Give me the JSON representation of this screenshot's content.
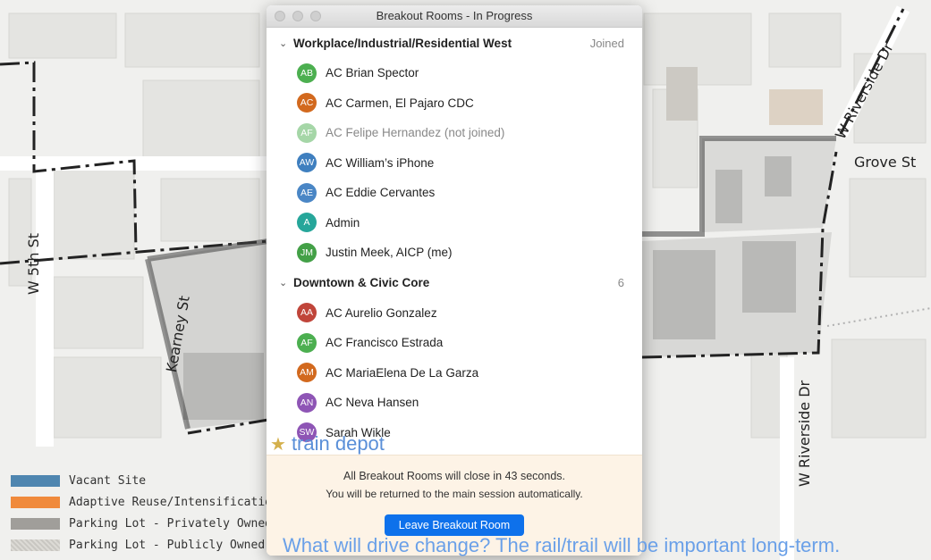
{
  "window": {
    "title": "Breakout Rooms - In Progress"
  },
  "rooms": [
    {
      "name": "Workplace/Industrial/Residential West",
      "status": "Joined",
      "participants": [
        {
          "initials": "AB",
          "name": "AC Brian Spector",
          "color": "#4caf50"
        },
        {
          "initials": "AC",
          "name": "AC Carmen, El Pajaro CDC",
          "color": "#d2691e"
        },
        {
          "initials": "AF",
          "name": "AC Felipe Hernandez (not joined)",
          "color": "#a5d6a7"
        },
        {
          "initials": "AW",
          "name": "AC William’s iPhone",
          "color": "#3f7fbf"
        },
        {
          "initials": "AE",
          "name": "AC Eddie Cervantes",
          "color": "#4a86c5"
        },
        {
          "initials": "A",
          "name": "Admin",
          "color": "#26a69a"
        },
        {
          "initials": "JM",
          "name": "Justin Meek, AICP (me)",
          "color": "#43a047"
        }
      ]
    },
    {
      "name": "Downtown & Civic Core",
      "status": "6",
      "participants": [
        {
          "initials": "AA",
          "name": "AC Aurelio Gonzalez",
          "color": "#c0453a"
        },
        {
          "initials": "AF",
          "name": "AC Francisco Estrada",
          "color": "#4caf50"
        },
        {
          "initials": "AM",
          "name": "AC MariaElena De La Garza",
          "color": "#d2691e"
        },
        {
          "initials": "AN",
          "name": "AC Neva Hansen",
          "color": "#8e55b5"
        },
        {
          "initials": "SW",
          "name": "Sarah Wikle",
          "color": "#8e55b5"
        }
      ]
    }
  ],
  "footer": {
    "countdown": "All Breakout Rooms will close in 43 seconds.",
    "notice": "You will be returned to the main session automatically.",
    "leave_button": "Leave Breakout Room"
  },
  "map": {
    "streets": {
      "w5th": "W 5th St",
      "kearney": "Kearney St",
      "riverside_top": "W Riverside Dr",
      "grove": "Grove St",
      "riverside_right": "W Riverside Dr"
    },
    "legend": [
      {
        "label": "Vacant Site",
        "color": "#4f86b0"
      },
      {
        "label": "Adaptive Reuse/Intensification",
        "color": "#f08a3c"
      },
      {
        "label": "Parking Lot - Privately Owned",
        "color": "#a09e9a"
      },
      {
        "label": "Parking Lot - Publicly Owned",
        "color": "#c9c7c2"
      }
    ]
  },
  "slide": {
    "train_depot": "train depot",
    "drive_change": "What will drive change? The rail/trail will be important long-term."
  }
}
